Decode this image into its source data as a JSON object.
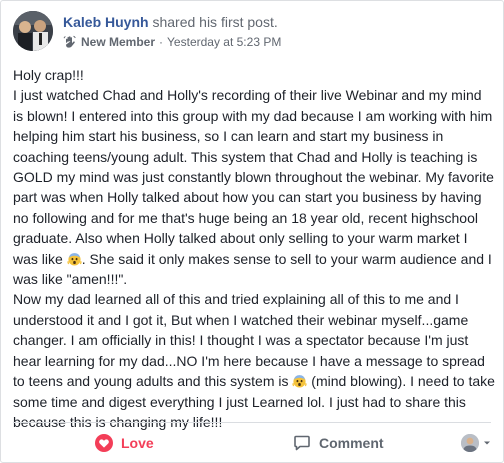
{
  "post": {
    "author_name": "Kaleb Huynh",
    "action_text": "shared his first post.",
    "badge_icon": "wave-hand-icon",
    "badge_label": "New Member",
    "separator": "·",
    "timestamp": "Yesterday at 5:23 PM"
  },
  "body": {
    "line1": "Holy crap!!!",
    "p1_part1": "I just watched Chad and Holly's recording of their live Webinar and my mind is blown! I entered into this group with my dad because I am working with him helping him start his business, so I can learn and start my business in coaching teens/young adult. This system that Chad and Holly is teaching is GOLD my mind was just constantly blown throughout the webinar. My favorite part was when Holly talked about how you can start you business by having no following and for me that's huge being an 18 year old, recent highschool graduate. Also when Holly talked about only selling to your warm market I was like ",
    "p1_part2": ". She said it only makes sense to sell to your warm audience and I was like \"amen!!!\".",
    "p2_part1": "Now my dad learned all of this and tried explaining all of this to me and I understood it and I got it, But when I watched their webinar myself...game changer. I am officially in this! I thought I was a spectator because I'm just hear learning for my dad...NO I'm here because I have a message to spread to teens and young adults and this system is ",
    "p2_part2": " (mind blowing). I need to take some time and digest everything I just Learned lol. I just had to share this because this is changing my life!!!",
    "emoji_icon": "shocked-face-emoji-icon"
  },
  "actions": {
    "love_label": "Love",
    "comment_label": "Comment"
  },
  "colors": {
    "author": "#365899",
    "love": "#f33e58",
    "muted": "#616770"
  }
}
